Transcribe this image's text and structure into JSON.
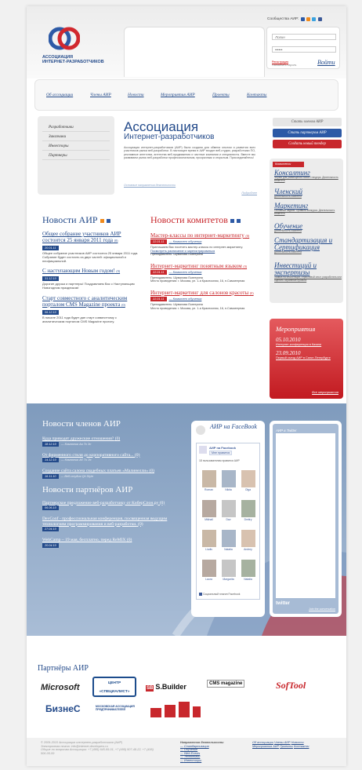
{
  "header": {
    "logo_line1": "АССОЦИАЦИЯ",
    "logo_line2": "ИНТЕРНЕТ-РАЗРАБОТЧИКОВ",
    "community_label": "Сообщества АИР:",
    "login_placeholder": "Логин",
    "password_value": "••••••",
    "register_link": "Регистрация",
    "forgot_text": "Напомнить пароль",
    "login_button": "Войти"
  },
  "nav": [
    "Об ассоциации",
    "Члены АИР",
    "Новости",
    "Мероприятия АИР",
    "Проекты",
    "Контакты"
  ],
  "left_menu": [
    "Разработчики",
    "Заказчики",
    "Инвесторы",
    "Партнеры"
  ],
  "intro": {
    "title": "Ассоциация",
    "subtitle": "Интернет-разработчиков",
    "text": "Ассоциация интернет-разработчиков (АИР) была создана для обмена опытом и развития всех участников рынка веб-разработки. В настоящее время в АИР входят веб-студии, разработчики ПО, рекламные агентства, агентства веб-продвижения и частные компании и специалисты. Вместе мы развиваем рынок веб-разработки профессиональным, прозрачным и открытым. Присоединяйтесь!",
    "directions_link": "Основные направления деятельности",
    "more_link": "Подробнее"
  },
  "buttons": {
    "become_member": "Стать членом АИР",
    "become_partner": "Стать партнером АИР",
    "create_tender": "Создать новый тендер"
  },
  "committees": {
    "label": "Комитеты",
    "items": [
      {
        "title": "Консалтинг",
        "desc": "Форма для размещения нового тендера. Деятельность комитета"
      },
      {
        "title": "Членский",
        "desc": "Деятельность комитета"
      },
      {
        "title": "Маркетинг",
        "desc": "Основные задачи. Правила конкурса. Деятельность комитета"
      },
      {
        "title": "Обучение",
        "desc": "Деятельность комитета"
      },
      {
        "title": "Стандартизация и Сертификация",
        "desc": "Деятельность комитета"
      },
      {
        "title": "Инвестиций и экспертизы",
        "desc": "Заявка на инвестиции, отраслевой опыт, разработать или оценить охранение проекта"
      }
    ]
  },
  "news": {
    "header": "Новости АИР",
    "items": [
      {
        "title": "Общее собрание участников АИР состоится 25 января 2011 года",
        "count": "(0)",
        "date": "20.01.11",
        "text": "Общее собрание участников АИР состоится 25 января 2011 года. Собрание будет состоять из двух частей: официальной и неофициальной."
      },
      {
        "title": "С наступающим Новым годом!",
        "count": "(0)",
        "date": "31.12.10",
        "text": "Дорогие друзья и партнеры! Поздравляем Вас с Наступающим Новогодним праздником!"
      },
      {
        "title": "Старт совместного с аналитическим порталом CMS Magazine проекта",
        "count": "(0)",
        "date": "06.12.10",
        "text": "В начале 2011 года будет дан старт совместному с аналитическим порталом CMS Magazine проекту."
      }
    ]
  },
  "committee_news": {
    "header": "Новости комитетов",
    "items": [
      {
        "title": "Мастер-классы по интернет-маркетингу",
        "count": "(0)",
        "date": "22.01.11",
        "source": "— Комитет обучения",
        "text": "Приглашаем Вас посетить мастер-классы по интернет-маркетингу.",
        "extra": "Посмотреть расписание и зарегистрироваться",
        "lecturer": "Преподаватель: Шувалова Екатерина"
      },
      {
        "title": "Интернет-маркетинг понятным языком",
        "count": "(0)",
        "date": "22.01.11",
        "source": "— Комитет обучения",
        "text": "Преподаватель: Шувалова Екатерина",
        "extra": "",
        "lecturer": "Место проведения: г. Москва, ул. 1-я Красносная, 16, п.Самоеерная"
      },
      {
        "title": "Интернет-маркетинг для салонов красоты",
        "count": "(0)",
        "date": "22.01.11",
        "source": "— Комитет обучения",
        "text": "Преподаватель: Шувалова Екатерина",
        "extra": "",
        "lecturer": "Место проведения: г. Москва, ул. 1-я Красносная, 16, п.Самоеерная"
      }
    ]
  },
  "events": {
    "header": "Мероприятия",
    "items": [
      {
        "date": "05.10.2010",
        "text": "Интернет-конференция в Казани"
      },
      {
        "date": "23.09.2010",
        "text": "Первый съезд АИР в Санкт-Петербурге"
      }
    ],
    "all_link": "Все мероприятия"
  },
  "members_news": {
    "header": "Новости членов АИР",
    "items": [
      {
        "title": "Куда приводят дружеские отношения?",
        "count": "(0)",
        "date": "18.12.10",
        "source": "— Компания Aa To Эс"
      },
      {
        "title": "От фирменного стиля до корпоративного сайта...",
        "count": "(0)",
        "date": "14.12.10",
        "source": "— Компания Аб То Эс"
      },
      {
        "title": "Создание сайта салона свадебных платьев «Малинелли»",
        "count": "(0)",
        "date": "16.11.10",
        "source": "— Веб-студия Qh Style"
      }
    ]
  },
  "partners_news": {
    "header": "Новости партнёров АИР",
    "items": [
      {
        "title": "Партнерское предложение веб-разработчику от КиберСпон.ру",
        "count": "(0)",
        "date": "06.06.10"
      },
      {
        "title": "DevConf - профессиональная конференция, посвященная ведущим технологиям программирования и веб-разработки.",
        "count": "(0)",
        "date": "27.04.10"
      },
      {
        "title": "WebCamp – 19 мая, бесплатно, перед ReMIX",
        "count": "(0)",
        "date": "20.04.10"
      }
    ]
  },
  "facebook": {
    "title": "АИР на FaceBook",
    "page_name": "АИР на Facebook",
    "like": "Мне нравится",
    "count_text": "18 пользователям нравится АИР",
    "people": [
      "Roman",
      "Nikita",
      "Olga",
      "Mikhail",
      "Dav",
      "Dmitry",
      "Liudis",
      "Natalia",
      "Andrey",
      "Laura",
      "Margarita",
      "Natalia"
    ],
    "social_plugin": "Социальный плагин Facebook"
  },
  "twitter": {
    "title": "АИР в Twitter",
    "join": "Join the conversation"
  },
  "partners": {
    "header": "Партнёры АИР",
    "logos": [
      "Microsoft",
      "ЦЕНТР «СПЕЦИАЛИСТ»",
      "S.Builder",
      "CMS magazine",
      "SofTool",
      "БизнеС",
      "МОСКОВСКАЯ АССОЦИАЦИЯ ПРЕДПРИНИМАТЕЛЕЙ"
    ]
  },
  "footer": {
    "copyright": "© 2009-2010 Ассоциация интернет-разработчиков (АИР)",
    "email": "Электронная почта: info@internet-developers.ru",
    "phones": "Общие по вопросам Ассоциации: +7 (495) 645-95-01, +7 (495) 507-48-22, +7 (495) 506-05-59",
    "directions_header": "Направления деятельности",
    "directions": [
      "Стандартизация",
      "Обучение",
      "Web Events",
      "Технологии",
      "Инвестиции"
    ],
    "links": [
      "Об ассоциации",
      "Члены АИР",
      "Новости",
      "Мероприятия АИР",
      "Проекты",
      "Контакты"
    ]
  }
}
